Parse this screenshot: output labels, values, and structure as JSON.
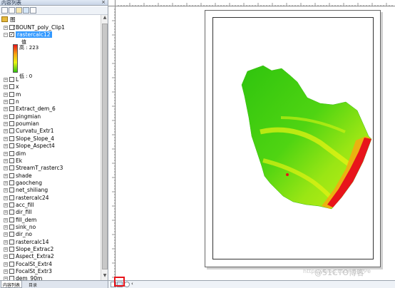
{
  "toc": {
    "title": "内容列表",
    "close": "×",
    "root_label": "图层",
    "legend": {
      "field_title": "值",
      "high_label": "高 : 223",
      "low_label": "低 : 0",
      "ramp_colors": [
        "#e8141b",
        "#f7a80f",
        "#e9f313",
        "#2fc40e"
      ]
    },
    "layers": [
      {
        "label": "BOUNT_poly_Clip1",
        "checked": false
      },
      {
        "label": "rastercalc12",
        "checked": true,
        "selected": true
      },
      {
        "label": "L",
        "checked": false
      },
      {
        "label": "x",
        "checked": false
      },
      {
        "label": "m",
        "checked": false
      },
      {
        "label": "n",
        "checked": false
      },
      {
        "label": "Extract_dem_6",
        "checked": false
      },
      {
        "label": "pingmian",
        "checked": false
      },
      {
        "label": "poumian",
        "checked": false
      },
      {
        "label": "Curvatu_Extr1",
        "checked": false
      },
      {
        "label": "Slope_Slope_4",
        "checked": false
      },
      {
        "label": "Slope_Aspect4",
        "checked": false
      },
      {
        "label": "dim",
        "checked": false
      },
      {
        "label": "Ek",
        "checked": false
      },
      {
        "label": "StreamT_rasterc3",
        "checked": false
      },
      {
        "label": "shade",
        "checked": false
      },
      {
        "label": "gaocheng",
        "checked": false
      },
      {
        "label": "net_shiliang",
        "checked": false
      },
      {
        "label": "rastercalc24",
        "checked": false
      },
      {
        "label": "acc_fill",
        "checked": false
      },
      {
        "label": "dir_fill",
        "checked": false
      },
      {
        "label": "fill_dem",
        "checked": false
      },
      {
        "label": "sink_no",
        "checked": false
      },
      {
        "label": "dir_no",
        "checked": false
      },
      {
        "label": "rastercalc14",
        "checked": false
      },
      {
        "label": "Slope_Extrac2",
        "checked": false
      },
      {
        "label": "Aspect_Extra2",
        "checked": false
      },
      {
        "label": "FocalSt_Extr4",
        "checked": false
      },
      {
        "label": "FocalSt_Extr3",
        "checked": false
      },
      {
        "label": "dem_90m",
        "checked": false
      }
    ],
    "tabs": [
      "内容列表",
      "目录"
    ]
  },
  "watermark": "https://blog.csdn.net/Pe",
  "watermark2": "@51CTO博客",
  "colors": {
    "accent": "#3399ff",
    "highlight_box": "#e8141b",
    "raster_green": "#2fc40e",
    "raster_yellow": "#e9f313",
    "raster_red": "#e8141b"
  }
}
